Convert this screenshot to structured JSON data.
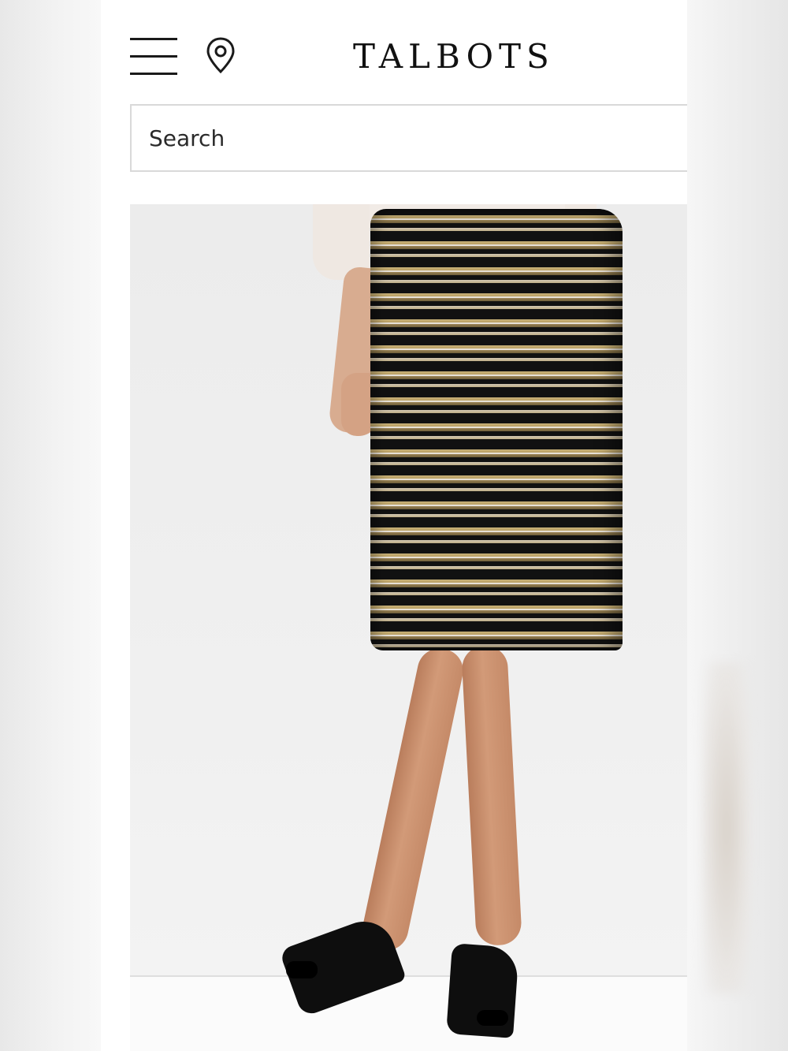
{
  "header": {
    "brand": "TALBOTS",
    "menu_icon": "hamburger-menu-icon",
    "location_icon": "map-pin-icon"
  },
  "search": {
    "placeholder": "Search"
  },
  "colors": {
    "background": "#ffffff",
    "text": "#111111",
    "search_border": "#d9d9d9"
  }
}
